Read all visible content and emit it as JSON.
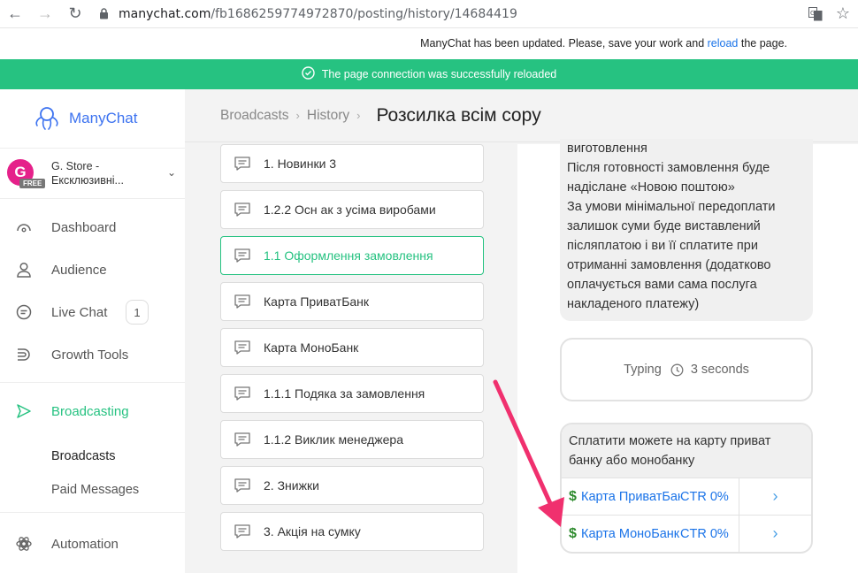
{
  "browser": {
    "url_host": "manychat.com",
    "url_path": "/fb1686259774972870/posting/history/14684419"
  },
  "update_notice": {
    "text_before": "ManyChat has been updated. Please, save your work and ",
    "link": "reload",
    "text_after": " the page."
  },
  "success_banner": {
    "text": "The page connection was successfully reloaded",
    "color": "#26c281"
  },
  "sidebar": {
    "logo_text": "ManyChat",
    "account": {
      "avatar_letter": "G",
      "plan_badge": "FREE",
      "name_line1": "G. Store -",
      "name_line2": "Ексклюзивні..."
    },
    "items": [
      {
        "label": "Dashboard",
        "icon": "dashboard-icon"
      },
      {
        "label": "Audience",
        "icon": "user-icon"
      },
      {
        "label": "Live Chat",
        "icon": "chat-icon",
        "badge": "1"
      },
      {
        "label": "Growth Tools",
        "icon": "growth-tools-icon"
      }
    ],
    "broadcasting": {
      "label": "Broadcasting",
      "icon": "send-icon",
      "sub_items": [
        "Broadcasts",
        "Paid Messages"
      ]
    },
    "automation": {
      "label": "Automation",
      "icon": "automation-icon"
    }
  },
  "header": {
    "crumb1": "Broadcasts",
    "crumb2": "History",
    "title": "Розсилка всім copy"
  },
  "flow_list": [
    "1. Новинки 3",
    "1.2.2 Осн ак з усіма виробами",
    "1.1 Оформлення замовлення",
    "Карта ПриватБанк",
    "Карта МоноБанк",
    "1.1.1 Подяка за замовлення",
    "1.1.2 Виклик менеджера",
    "2. Знижки",
    "3. Акція на сумку"
  ],
  "selected_index": 2,
  "preview": {
    "message_text": "виготовлення\nПісля готовності замовлення буде надіслане «Новою поштою»\nЗа умови мінімальної передоплати залишок суми буде виставлений післяплатою і ви її сплатите при отриманні замовлення (додатково оплачується вами сама послуга накладеного платежу)",
    "typing_label": "Typing",
    "typing_duration": "3 seconds",
    "card_text": "Сплатити можете на карту приват банку або монобанку",
    "buttons": [
      {
        "label": "Карта ПриватБанк",
        "ctr": "CTR 0%"
      },
      {
        "label": "Карта МоноБанк",
        "ctr": "CTR 0%"
      }
    ]
  },
  "colors": {
    "accent_green": "#26c281",
    "link_blue": "#1a73e8",
    "annotation_arrow": "#f0306e"
  }
}
